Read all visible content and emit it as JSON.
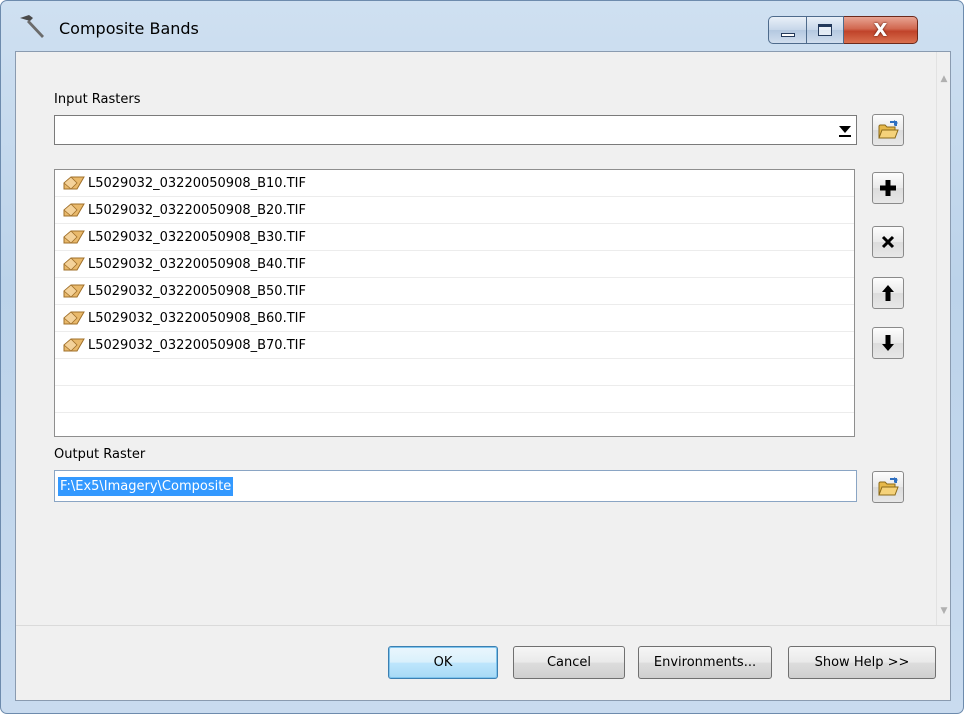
{
  "window": {
    "title": "Composite Bands",
    "icon": "hammer-icon",
    "controls": {
      "minimize": "minimize-icon",
      "maximize": "maximize-icon",
      "close": "close-icon"
    }
  },
  "form": {
    "input_rasters": {
      "label": "Input Rasters",
      "value": "",
      "items": [
        "L5029032_03220050908_B10.TIF",
        "L5029032_03220050908_B20.TIF",
        "L5029032_03220050908_B30.TIF",
        "L5029032_03220050908_B40.TIF",
        "L5029032_03220050908_B50.TIF",
        "L5029032_03220050908_B60.TIF",
        "L5029032_03220050908_B70.TIF"
      ],
      "item_icon": "raster-layer-icon",
      "list_buttons": [
        "add-icon",
        "remove-icon",
        "move-up-icon",
        "move-down-icon"
      ]
    },
    "output_raster": {
      "label": "Output Raster",
      "value": "F:\\Ex5\\Imagery\\Composite"
    }
  },
  "buttons": {
    "ok": "OK",
    "cancel": "Cancel",
    "environments": "Environments...",
    "show_help": "Show Help >>"
  },
  "colors": {
    "selection": "#3399ff",
    "close_button": "#c0432a",
    "title_bar": "#bcd3ea"
  }
}
